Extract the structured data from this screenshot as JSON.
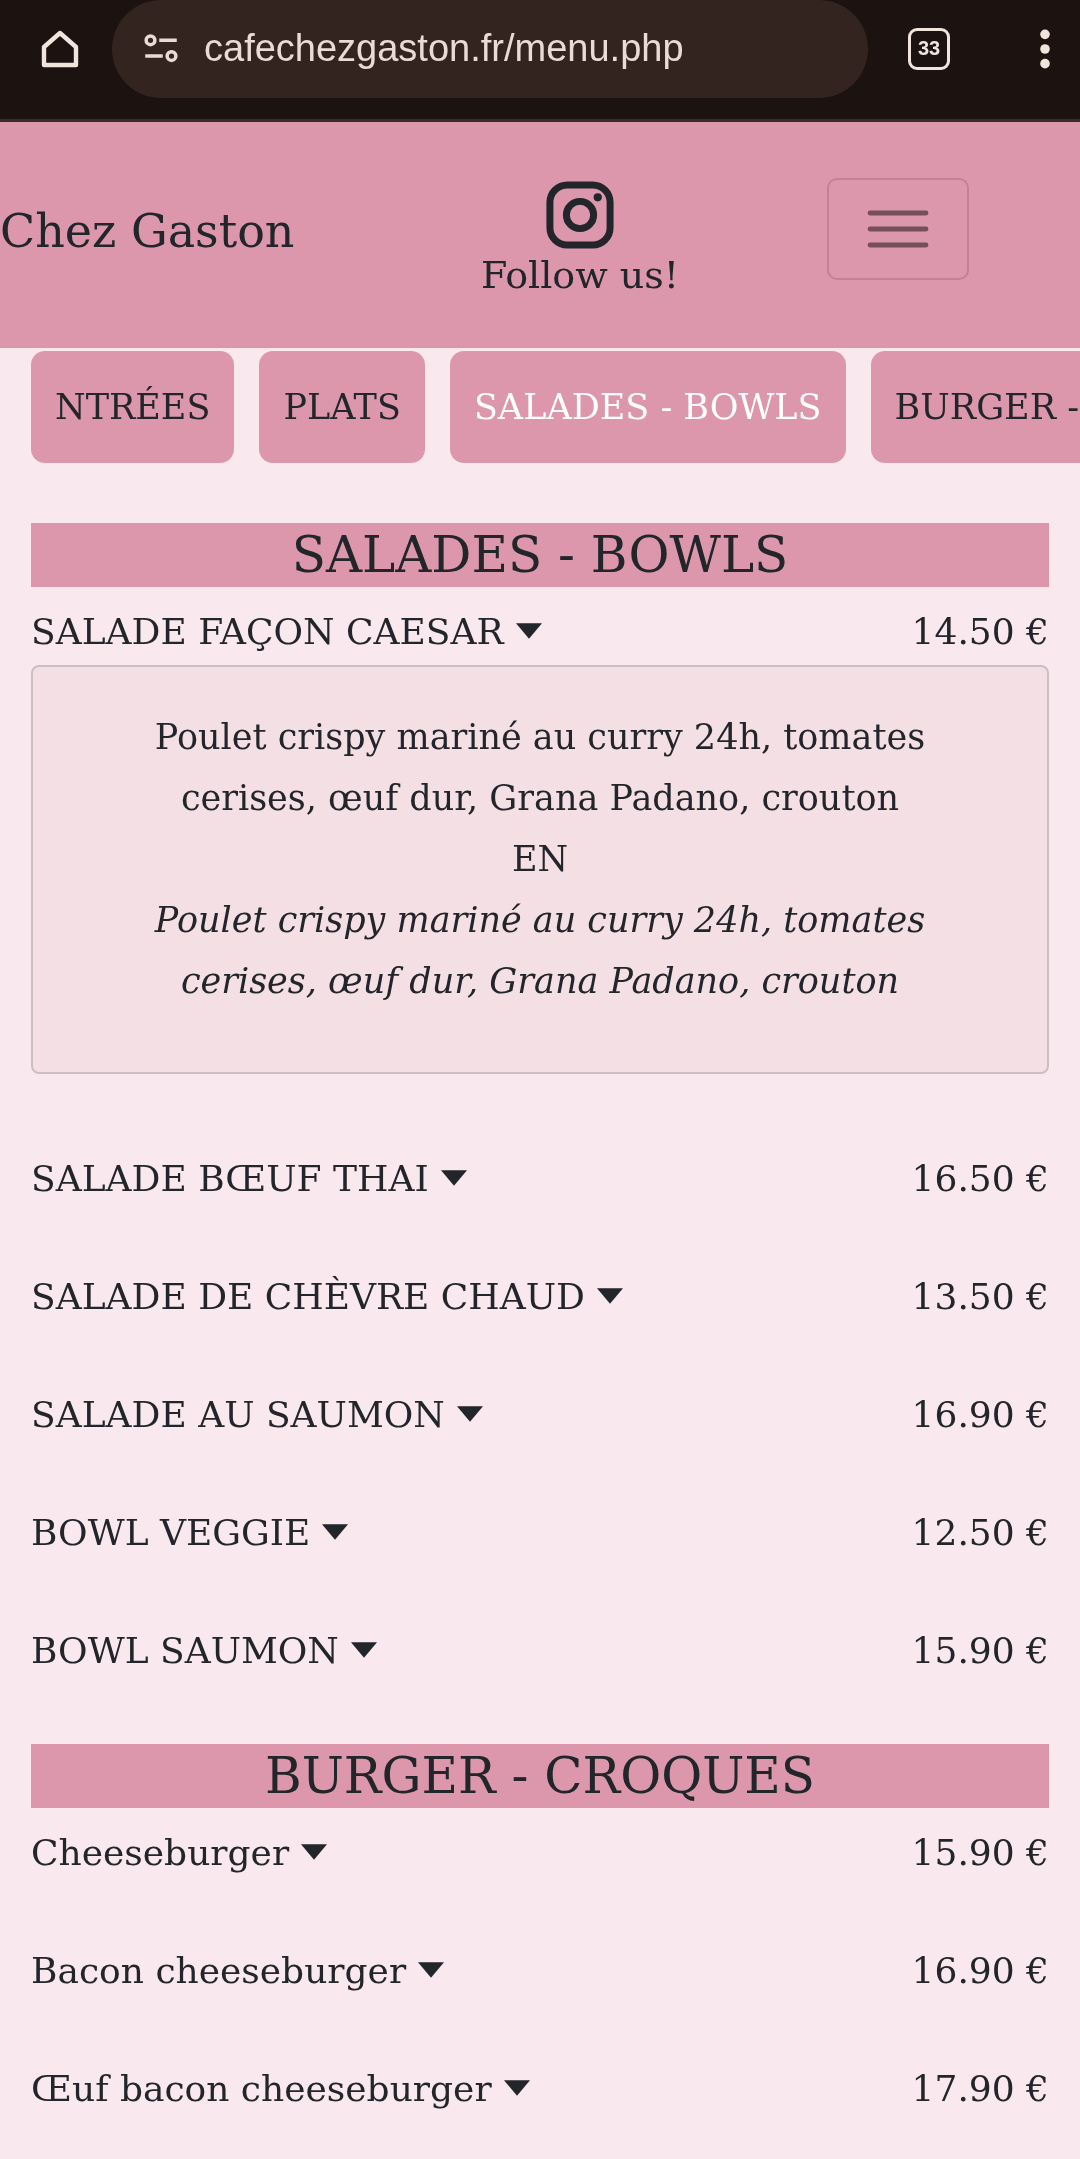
{
  "browser": {
    "url": "cafechezgaston.fr/menu.php",
    "tab_count": "33"
  },
  "header": {
    "brand": "Chez Gaston",
    "follow_text": "Follow us!"
  },
  "tabs": [
    {
      "label": "NTRÉES",
      "selected": false
    },
    {
      "label": "PLATS",
      "selected": false
    },
    {
      "label": "SALADES - BOWLS",
      "selected": true
    },
    {
      "label": "BURGER -",
      "selected": false
    }
  ],
  "sections": [
    {
      "title": "SALADES - BOWLS",
      "items": [
        {
          "name": "SALADE FAÇON CAESAR",
          "price": "14.50 €",
          "description": "Poulet crispy mariné au curry 24h, tomates cerises, œuf dur, Grana Padano, crouton",
          "en_label": "EN",
          "description_en": "Poulet crispy mariné au curry 24h, tomates cerises, œuf dur, Grana Padano, crouton"
        },
        {
          "name": "SALADE BŒUF THAI",
          "price": "16.50 €"
        },
        {
          "name": "SALADE DE CHÈVRE CHAUD",
          "price": "13.50 €"
        },
        {
          "name": "SALADE AU SAUMON",
          "price": "16.90 €"
        },
        {
          "name": "BOWL VEGGIE",
          "price": "12.50 €"
        },
        {
          "name": "BOWL SAUMON",
          "price": "15.90 €"
        }
      ]
    },
    {
      "title": "BURGER - CROQUES",
      "items": [
        {
          "name": "Cheeseburger",
          "price": "15.90 €"
        },
        {
          "name": "Bacon cheeseburger",
          "price": "16.90 €"
        },
        {
          "name": "Œuf bacon cheeseburger",
          "price": "17.90 €"
        }
      ]
    }
  ]
}
